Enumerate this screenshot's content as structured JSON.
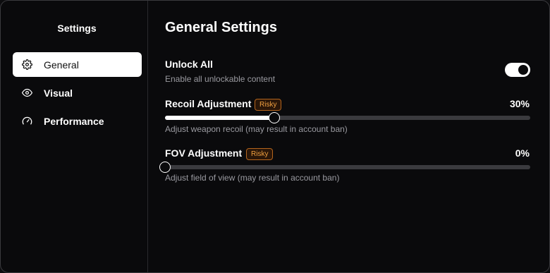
{
  "sidebar": {
    "title": "Settings",
    "items": [
      {
        "label": "General",
        "icon": "gear-icon",
        "active": true
      },
      {
        "label": "Visual",
        "icon": "eye-icon",
        "active": false
      },
      {
        "label": "Performance",
        "icon": "gauge-icon",
        "active": false
      }
    ]
  },
  "main": {
    "title": "General Settings",
    "unlock_all": {
      "title": "Unlock All",
      "description": "Enable all unlockable content",
      "enabled": true
    },
    "recoil": {
      "title": "Recoil Adjustment",
      "badge": "Risky",
      "value_text": "30%",
      "value": 30,
      "description": "Adjust weapon recoil (may result in account ban)"
    },
    "fov": {
      "title": "FOV Adjustment",
      "badge": "Risky",
      "value_text": "0%",
      "value": 0,
      "description": "Adjust field of view (may result in account ban)"
    }
  },
  "colors": {
    "background": "#0a0a0c",
    "accent": "#ffffff",
    "badge_text": "#f0a040",
    "badge_border": "#b5651d"
  }
}
